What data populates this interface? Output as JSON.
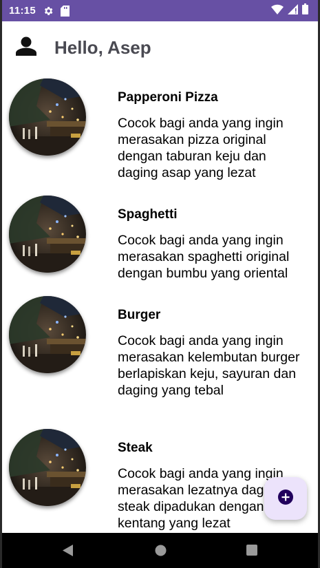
{
  "status_bar": {
    "time": "11:15",
    "icons": [
      "gear-icon",
      "sd-card-icon",
      "wifi-icon",
      "signal-icon",
      "battery-icon"
    ],
    "color": "#6750a4"
  },
  "header": {
    "greeting": "Hello, Asep",
    "icon": "person-icon"
  },
  "menu": {
    "items": [
      {
        "title": "Papperoni Pizza",
        "description": "Cocok bagi anda yang ingin merasakan pizza original dengan taburan keju dan daging asap yang lezat"
      },
      {
        "title": "Spaghetti",
        "description": "Cocok bagi anda yang ingin merasakan spaghetti original dengan bumbu yang oriental"
      },
      {
        "title": "Burger",
        "description": "Cocok bagi anda yang ingin merasakan kelembutan burger berlapiskan keju, sayuran dan daging yang tebal"
      },
      {
        "title": "Steak",
        "description": "Cocok bagi anda yang ingin merasakan lezatnya daging steak dipadukan dengan kentang yang lezat"
      }
    ]
  },
  "fab": {
    "icon": "add-circle-icon",
    "background": "#ece3fb"
  },
  "navigation": {
    "buttons": [
      "back-icon",
      "home-icon",
      "recents-icon"
    ]
  }
}
